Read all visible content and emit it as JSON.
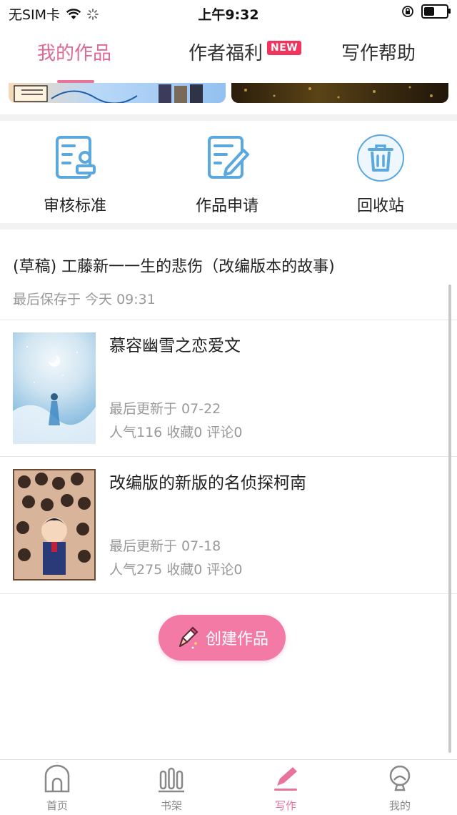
{
  "status_bar": {
    "carrier": "无SIM卡",
    "time": "上午9:32",
    "battery_level": 0.55
  },
  "tabs": [
    {
      "label": "我的作品",
      "active": true
    },
    {
      "label": "作者福利",
      "badge": "NEW"
    },
    {
      "label": "写作帮助"
    }
  ],
  "shortcuts": [
    {
      "label": "审核标准",
      "icon": "review-standard-icon"
    },
    {
      "label": "作品申请",
      "icon": "work-apply-icon"
    },
    {
      "label": "回收站",
      "icon": "trash-icon"
    }
  ],
  "draft": {
    "title": "(草稿) 工藤新一一生的悲伤（改编版本的故事)",
    "saved": "最后保存于 今天 09:31"
  },
  "works": [
    {
      "title": "慕容幽雪之恋爱文",
      "updated": "最后更新于 07-22",
      "stats": "人气116  收藏0  评论0"
    },
    {
      "title": "改编版的新版的名侦探柯南",
      "updated": "最后更新于 07-18",
      "stats": "人气275  收藏0  评论0"
    }
  ],
  "create_button": "创建作品",
  "bottom_nav": [
    {
      "label": "首页"
    },
    {
      "label": "书架"
    },
    {
      "label": "写作",
      "active": true
    },
    {
      "label": "我的"
    }
  ],
  "colors": {
    "accent": "#e8749a",
    "button": "#f27aa5",
    "icon_blue": "#5aa8de",
    "badge": "#f0365f"
  }
}
